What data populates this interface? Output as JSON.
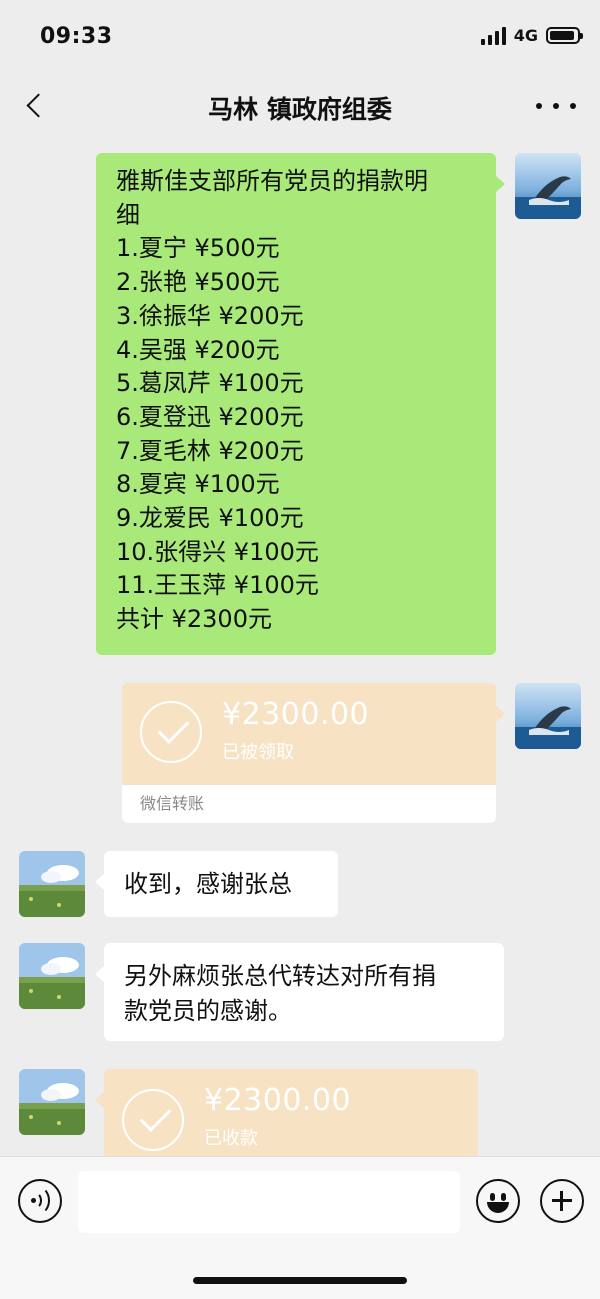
{
  "status_bar": {
    "time": "09:33",
    "network": "4G"
  },
  "nav": {
    "title": "马林 镇政府组委",
    "back_icon": "chevron-left-icon",
    "more_icon": "more-dots-icon"
  },
  "messages": {
    "donation_list": {
      "lines": [
        "雅斯佳支部所有党员的捐款明",
        "细",
        "1.夏宁 ¥500元",
        "2.张艳 ¥500元",
        "3.徐振华 ¥200元",
        "4.吴强 ¥200元",
        "5.葛凤芹 ¥100元",
        "6.夏登迅 ¥200元",
        "7.夏毛林 ¥200元",
        "8.夏宾 ¥100元",
        "9.龙爱民 ¥100元",
        "10.张得兴 ¥100元",
        "11.王玉萍 ¥100元",
        "共计 ¥2300元"
      ]
    },
    "transfer_sent": {
      "amount": "¥2300.00",
      "status": "已被领取",
      "footer": "微信转账"
    },
    "reply_1": {
      "text": "收到，感谢张总"
    },
    "reply_2": {
      "line1": "另外麻烦张总代转达对所有捐",
      "line2": "款党员的感谢。"
    },
    "transfer_received": {
      "amount": "¥2300.00",
      "status": "已收款"
    }
  },
  "colors": {
    "self_bubble": "#a9e97a",
    "transfer_card": "#f7e2c4",
    "background": "#ededed"
  },
  "input_bar": {
    "voice_icon": "voice-icon",
    "emoji_icon": "emoji-icon",
    "plus_icon": "plus-icon"
  }
}
